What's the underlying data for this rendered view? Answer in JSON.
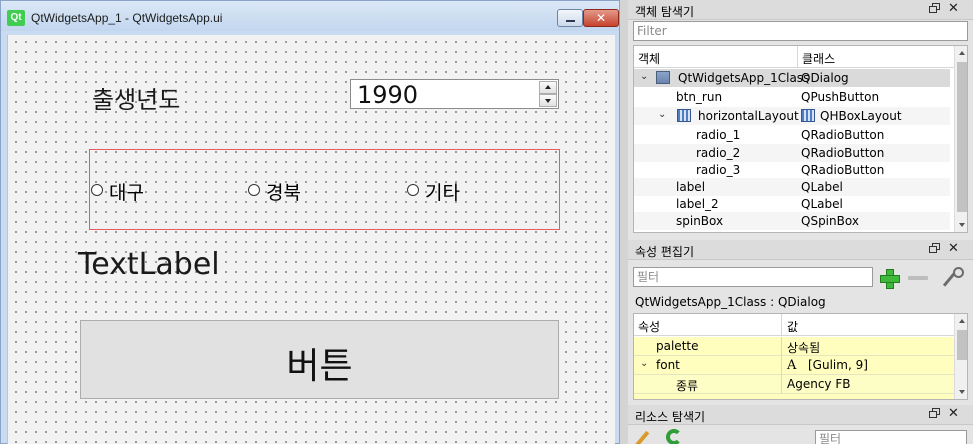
{
  "form_window": {
    "title": "QtWidgetsApp_1 - QtWidgetsApp.ui",
    "qt_icon": "Qt",
    "close_glyph": "✕"
  },
  "form": {
    "label_birthyear": "출생년도",
    "spinbox_value": "1990",
    "radios": [
      "대구",
      "경북",
      "기타"
    ],
    "text_label": "TextLabel",
    "button_label": "버튼"
  },
  "object_inspector": {
    "title": "객체 탐색기",
    "filter_placeholder": "Filter",
    "col_object": "객체",
    "col_class": "클래스",
    "rows": [
      {
        "name": "QtWidgetsApp_1Class",
        "cls": "QDialog"
      },
      {
        "name": "btn_run",
        "cls": "QPushButton"
      },
      {
        "name": "horizontalLayout",
        "cls": "QHBoxLayout"
      },
      {
        "name": "radio_1",
        "cls": "QRadioButton"
      },
      {
        "name": "radio_2",
        "cls": "QRadioButton"
      },
      {
        "name": "radio_3",
        "cls": "QRadioButton"
      },
      {
        "name": "label",
        "cls": "QLabel"
      },
      {
        "name": "label_2",
        "cls": "QLabel"
      },
      {
        "name": "spinBox",
        "cls": "QSpinBox"
      }
    ]
  },
  "property_editor": {
    "title": "속성 편집기",
    "filter_placeholder": "필터",
    "object_label": "QtWidgetsApp_1Class : QDialog",
    "col_property": "속성",
    "col_value": "값",
    "rows": [
      {
        "name": "palette",
        "value": "상속됨"
      },
      {
        "name": "font",
        "value": "[Gulim, 9]",
        "glyph": "A"
      },
      {
        "name": "종류",
        "value": "Agency FB"
      }
    ]
  },
  "resource_browser": {
    "title": "리소스 탐색기",
    "filter_placeholder": "필터"
  },
  "panel_icons": {
    "float": "float-icon",
    "close": "✕"
  }
}
